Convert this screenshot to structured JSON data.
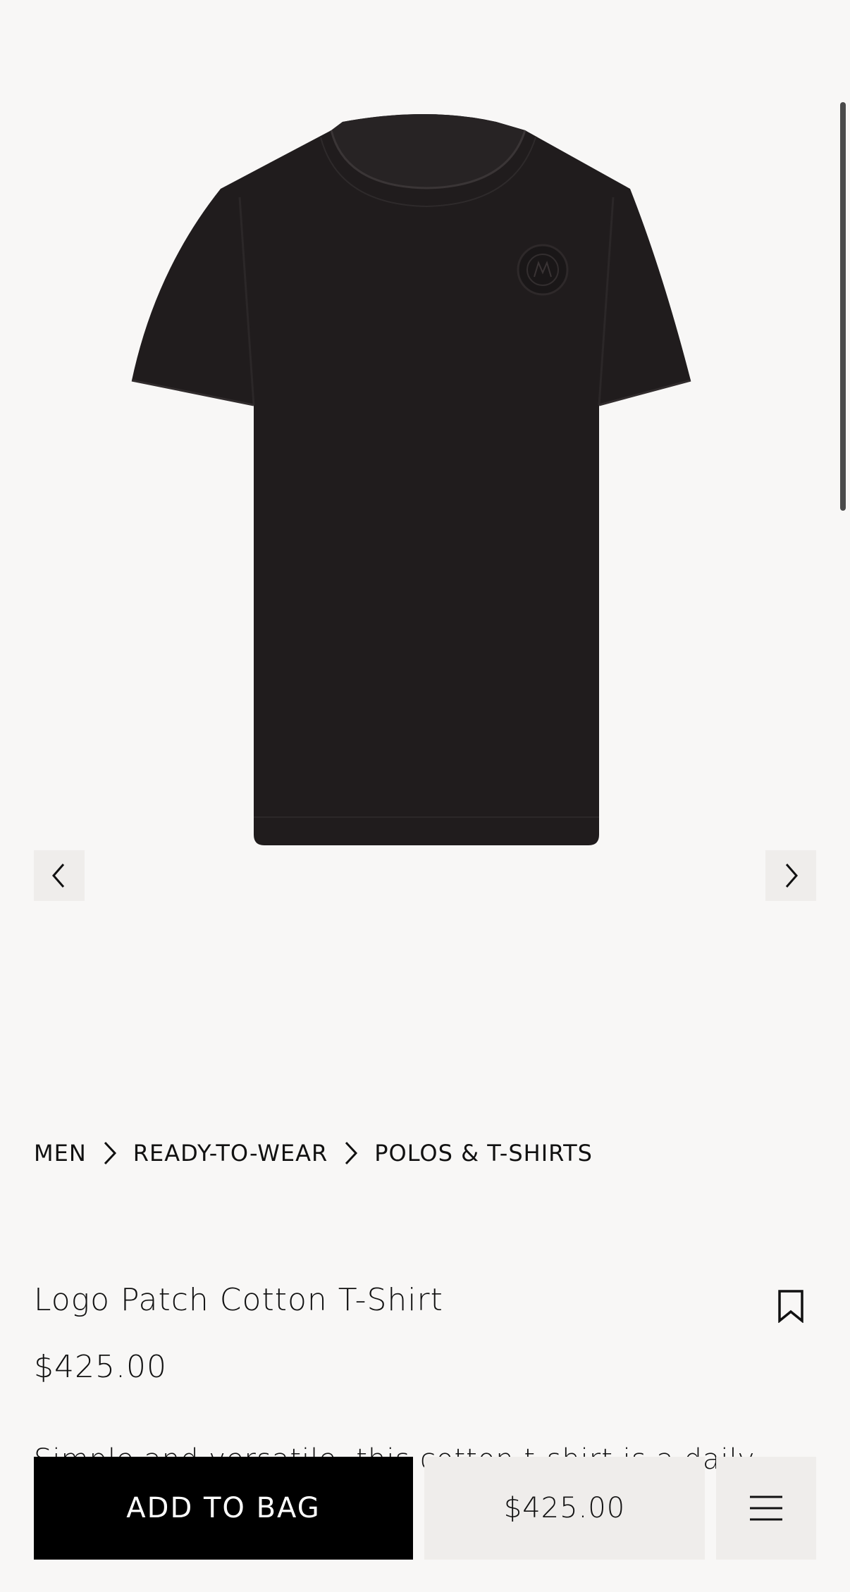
{
  "gallery": {
    "image_alt": "Logo Patch Cotton T-Shirt, black",
    "prev_icon": "chevron-left-icon",
    "next_icon": "chevron-right-icon"
  },
  "breadcrumb": {
    "items": [
      "MEN",
      "READY-TO-WEAR",
      "POLOS & T-SHIRTS"
    ],
    "separator_icon": "chevron-right-icon"
  },
  "product": {
    "title": "Logo Patch Cotton T-Shirt",
    "price": "$425.00",
    "description": "Simple and versatile, this cotton t-shirt is a daily",
    "bookmark_icon": "bookmark-icon"
  },
  "bottom_bar": {
    "add_to_bag_label": "ADD TO BAG",
    "price_label": "$425.00",
    "menu_icon": "menu-icon"
  },
  "colors": {
    "background": "#f8f7f6",
    "primary_button": "#000000",
    "secondary_button": "#efedeb",
    "product": "#201c1d"
  }
}
